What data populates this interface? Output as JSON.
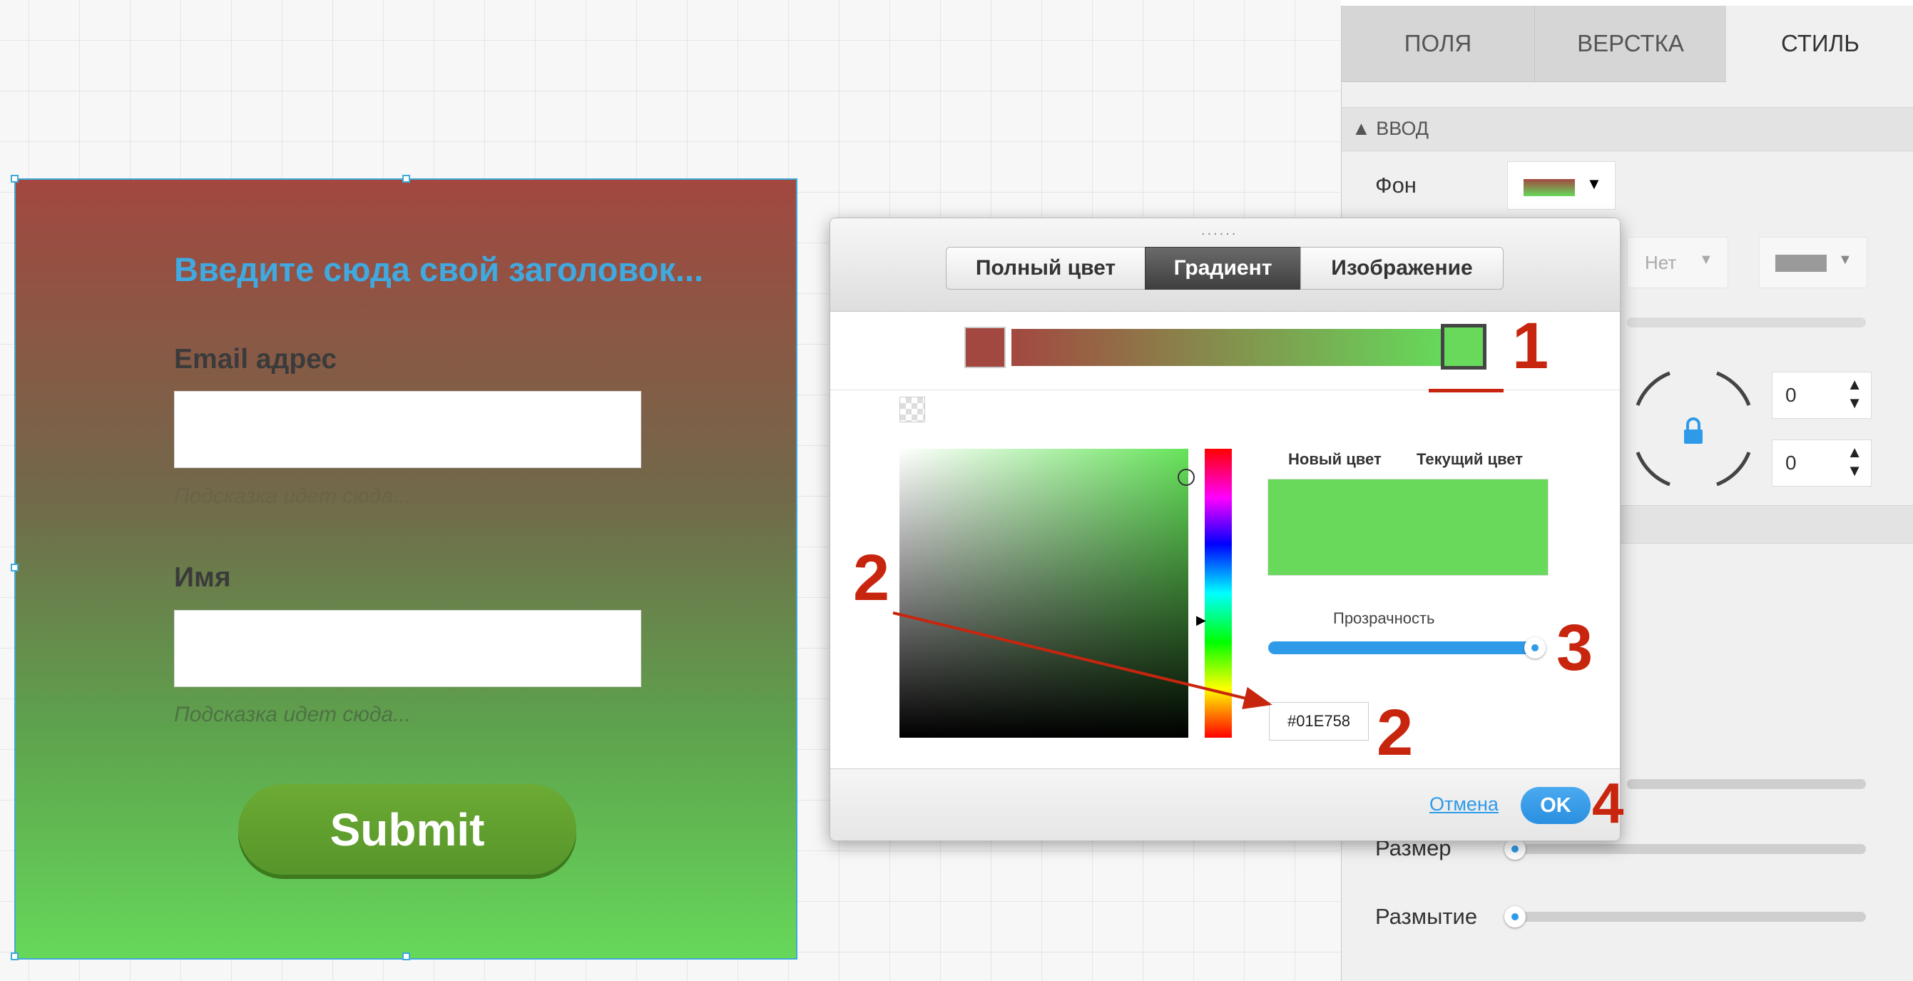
{
  "form": {
    "title": "Введите сюда свой заголовок...",
    "email_label": "Email адрес",
    "email_hint": "Подсказка идет сюда...",
    "name_label": "Имя",
    "name_hint": "Подсказка идет сюда...",
    "submit_label": "Submit"
  },
  "panel": {
    "tabs": [
      "ПОЛЯ",
      "ВЕРСТКА",
      "СТИЛЬ"
    ],
    "section_input": "▲ ВВОД",
    "background_label": "Фон",
    "border_select": "Нет",
    "radius_values": [
      "0",
      "0"
    ],
    "size_label": "Размер",
    "blur_label": "Размытие"
  },
  "color_picker": {
    "modes": [
      "Полный цвет",
      "Градиент",
      "Изображение"
    ],
    "active_mode": "Градиент",
    "new_color_label": "Новый цвет",
    "current_color_label": "Текущий цвет",
    "opacity_label": "Прозрачность",
    "opacity": 1.0,
    "hex_value": "#01E758",
    "cancel_label": "Отмена",
    "ok_label": "OK",
    "gradient_start": "#a24840",
    "gradient_end": "#66d85a",
    "preview_color": "#68d95a"
  },
  "annotations": [
    "1",
    "2",
    "2",
    "3",
    "4"
  ]
}
